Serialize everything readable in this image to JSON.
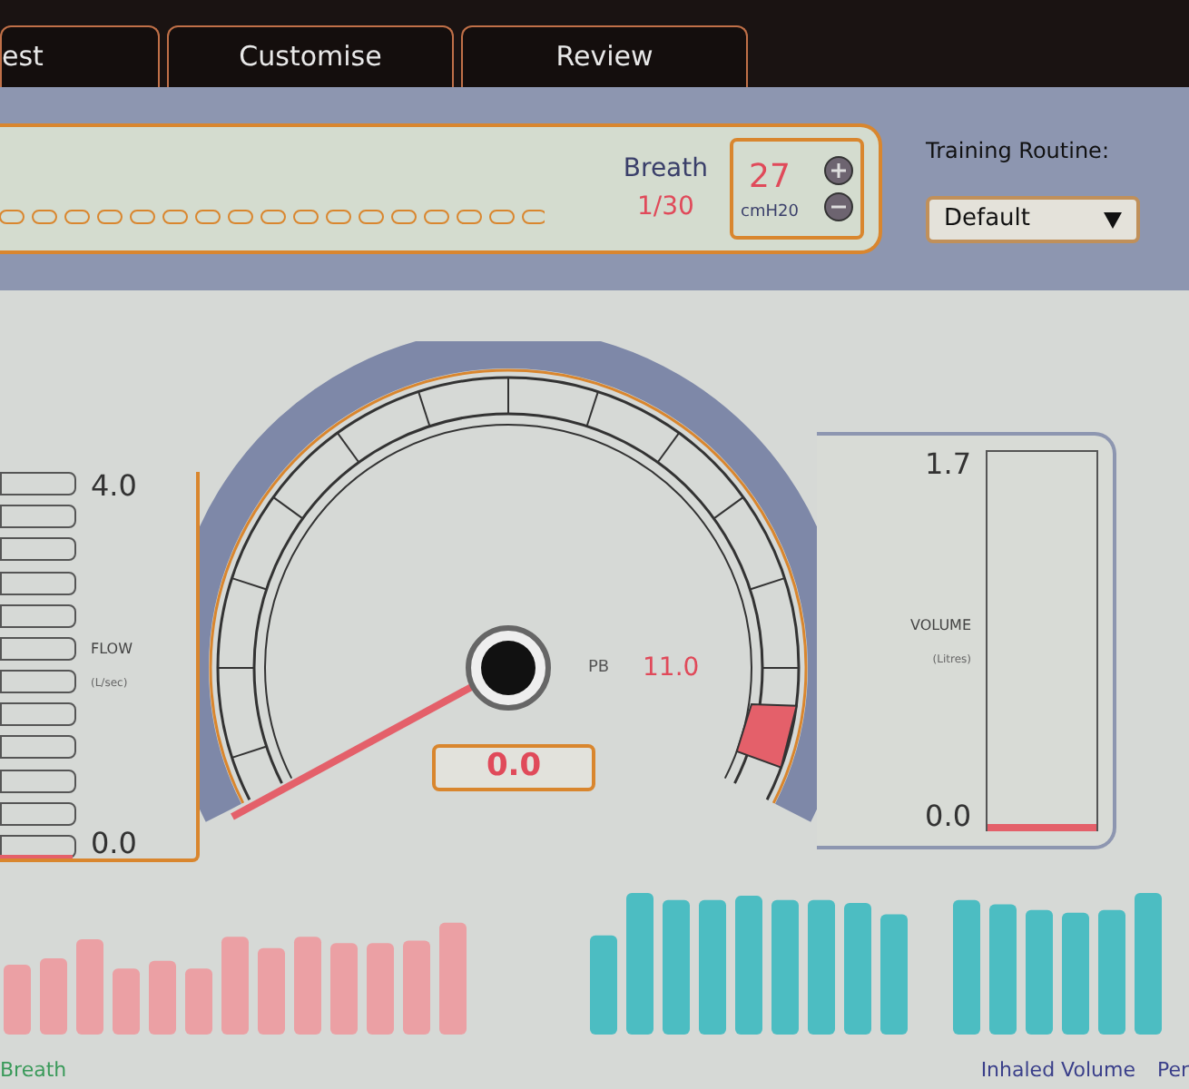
{
  "tabs": [
    {
      "label": "est"
    },
    {
      "label": "Customise"
    },
    {
      "label": "Review"
    }
  ],
  "breath_panel": {
    "label": "Breath",
    "count": "1/30",
    "pressure": "27",
    "unit": "cmH20"
  },
  "training_routine": {
    "label": "Training Routine:",
    "value": "Default"
  },
  "flow": {
    "max": "4.0",
    "min": "0.0",
    "label": "FLOW",
    "unit": "(L/sec)",
    "level": 0
  },
  "gauge": {
    "pb_label": "PB",
    "pb_value": "11.0",
    "reading": "0.0"
  },
  "volume": {
    "max": "1.7",
    "min": "0.0",
    "label": "VOLUME",
    "unit": "(Litres)",
    "level": 0
  },
  "footer": {
    "left_label": "Breath",
    "right_label": "Inhaled Volume",
    "right_label_2": "Per"
  }
}
